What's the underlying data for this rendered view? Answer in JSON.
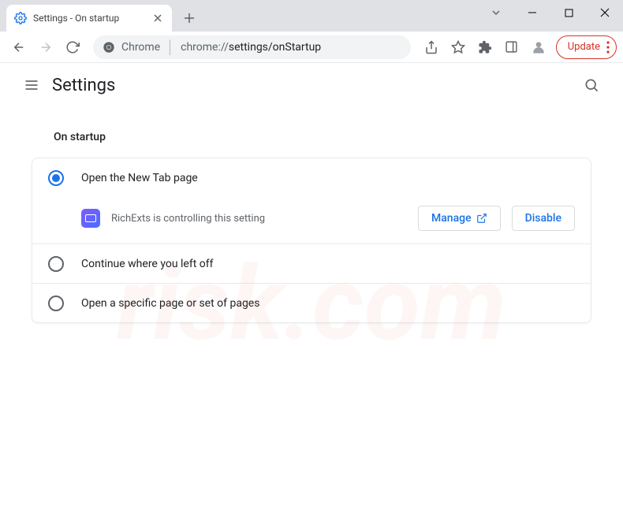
{
  "tab": {
    "title": "Settings - On startup"
  },
  "omnibox": {
    "scheme_label": "Chrome",
    "url_prefix": "chrome://",
    "url_path": "settings/onStartup"
  },
  "update_chip": {
    "label": "Update"
  },
  "header": {
    "title": "Settings"
  },
  "section": {
    "title": "On startup"
  },
  "options": {
    "open_new_tab": {
      "label": "Open the New Tab page",
      "selected": true
    },
    "continue": {
      "label": "Continue where you left off",
      "selected": false
    },
    "specific": {
      "label": "Open a specific page or set of pages",
      "selected": false
    }
  },
  "notice": {
    "extension_name": "RichExts",
    "text": "RichExts is controlling this setting",
    "manage_label": "Manage",
    "disable_label": "Disable"
  },
  "colors": {
    "accent": "#1a73e8",
    "danger": "#d93025"
  }
}
